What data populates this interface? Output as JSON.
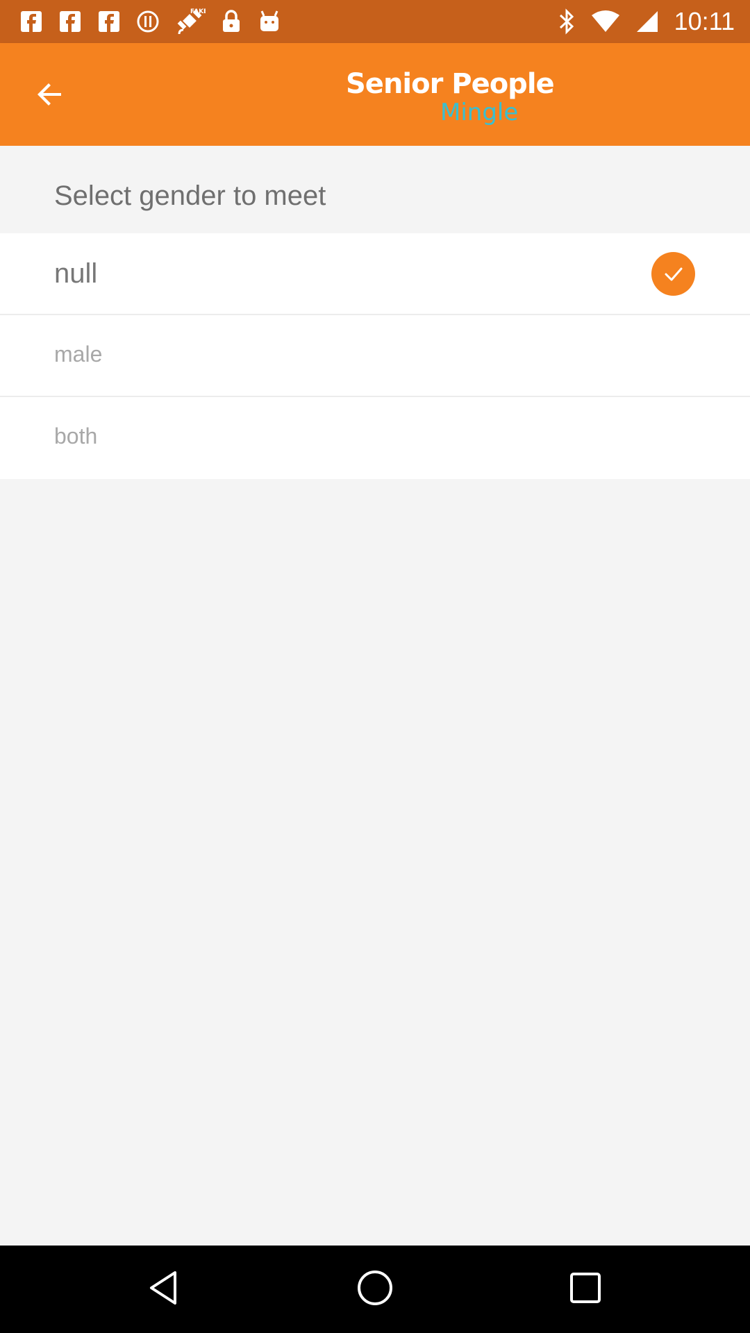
{
  "status_bar": {
    "time": "10:11",
    "left_icons": [
      "facebook-icon",
      "facebook-icon",
      "facebook-icon",
      "alert-icon",
      "fake-gps-icon",
      "lock-icon",
      "android-icon"
    ],
    "right_icons": [
      "bluetooth-icon",
      "wifi-icon",
      "signal-icon"
    ]
  },
  "app_bar": {
    "back_icon": "arrow-back-icon",
    "logo_line1": "Senior People",
    "logo_line2": "Mingle",
    "background_color": "#f5821f",
    "logo_accent_color": "#39bfd0"
  },
  "section": {
    "title": "Select gender to meet"
  },
  "options": [
    {
      "label": "null",
      "selected": true
    },
    {
      "label": "male",
      "selected": false
    },
    {
      "label": "both",
      "selected": false
    }
  ],
  "nav_bar": {
    "icons": [
      "back-triangle-icon",
      "home-circle-icon",
      "recents-square-icon"
    ]
  }
}
